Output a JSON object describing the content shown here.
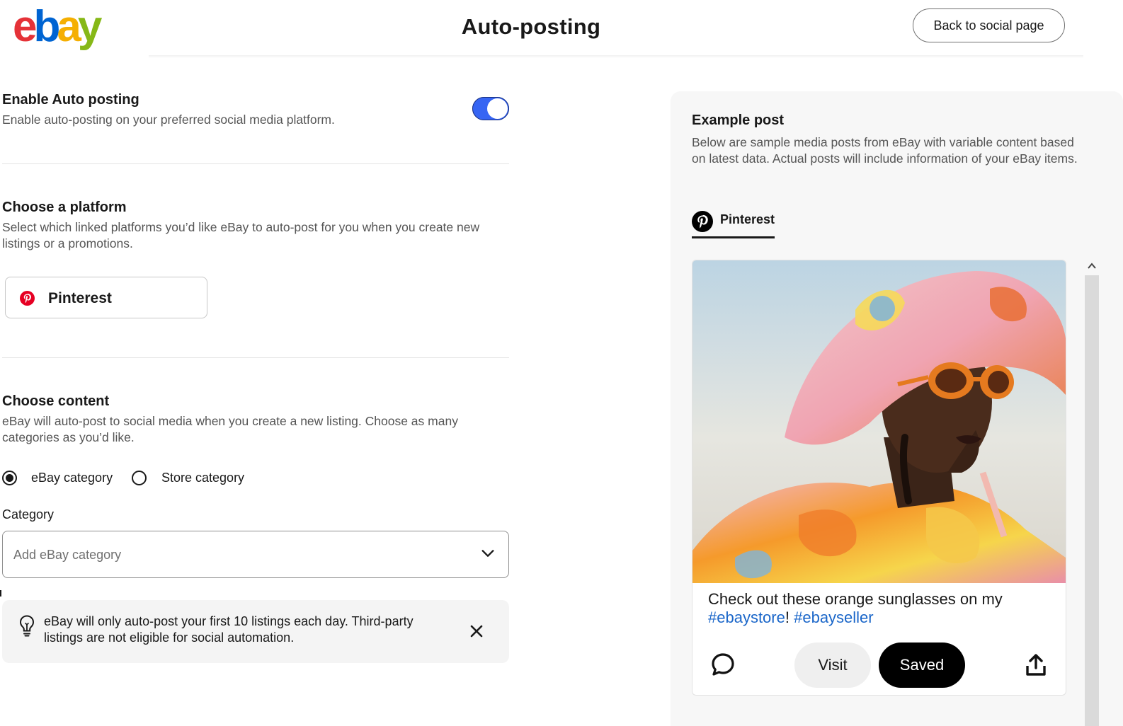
{
  "header": {
    "logo_text": "ebay",
    "title": "Auto-posting",
    "back_button": "Back to social page"
  },
  "auto_posting": {
    "title": "Enable Auto posting",
    "description": "Enable auto-posting on your preferred social media platform.",
    "enabled": true
  },
  "platform": {
    "title": "Choose a platform",
    "description": "Select which linked platforms you’d like eBay to auto-post for you when you create new listings or a promotions.",
    "options": [
      {
        "label": "Pinterest",
        "icon": "pinterest-icon"
      }
    ]
  },
  "content": {
    "title": "Choose content",
    "description": "eBay will auto-post to social media when you create a new listing. Choose as many categories as you’d like.",
    "radios": [
      {
        "label": "eBay category",
        "selected": true
      },
      {
        "label": "Store category",
        "selected": false
      }
    ],
    "category_label": "Category",
    "category_placeholder": "Add eBay category"
  },
  "tip": {
    "text": "eBay will only auto-post your first 10 listings each day. Third-party listings are not eligible for social automation.",
    "icon": "lightbulb-icon"
  },
  "example": {
    "title": "Example post",
    "description": "Below are sample media posts from eBay with variable content based on latest data. Actual posts will include information of your eBay items.",
    "tab": "Pinterest",
    "post": {
      "caption_prefix": "Check out these orange sunglasses on my",
      "tag1": "#ebaystore",
      "separator": "!",
      "tag2": "#ebayseller",
      "visit": "Visit",
      "saved": "Saved"
    }
  },
  "colors": {
    "accent": "#3665f3",
    "pinterest": "#e60023",
    "link": "#1a66c9"
  }
}
